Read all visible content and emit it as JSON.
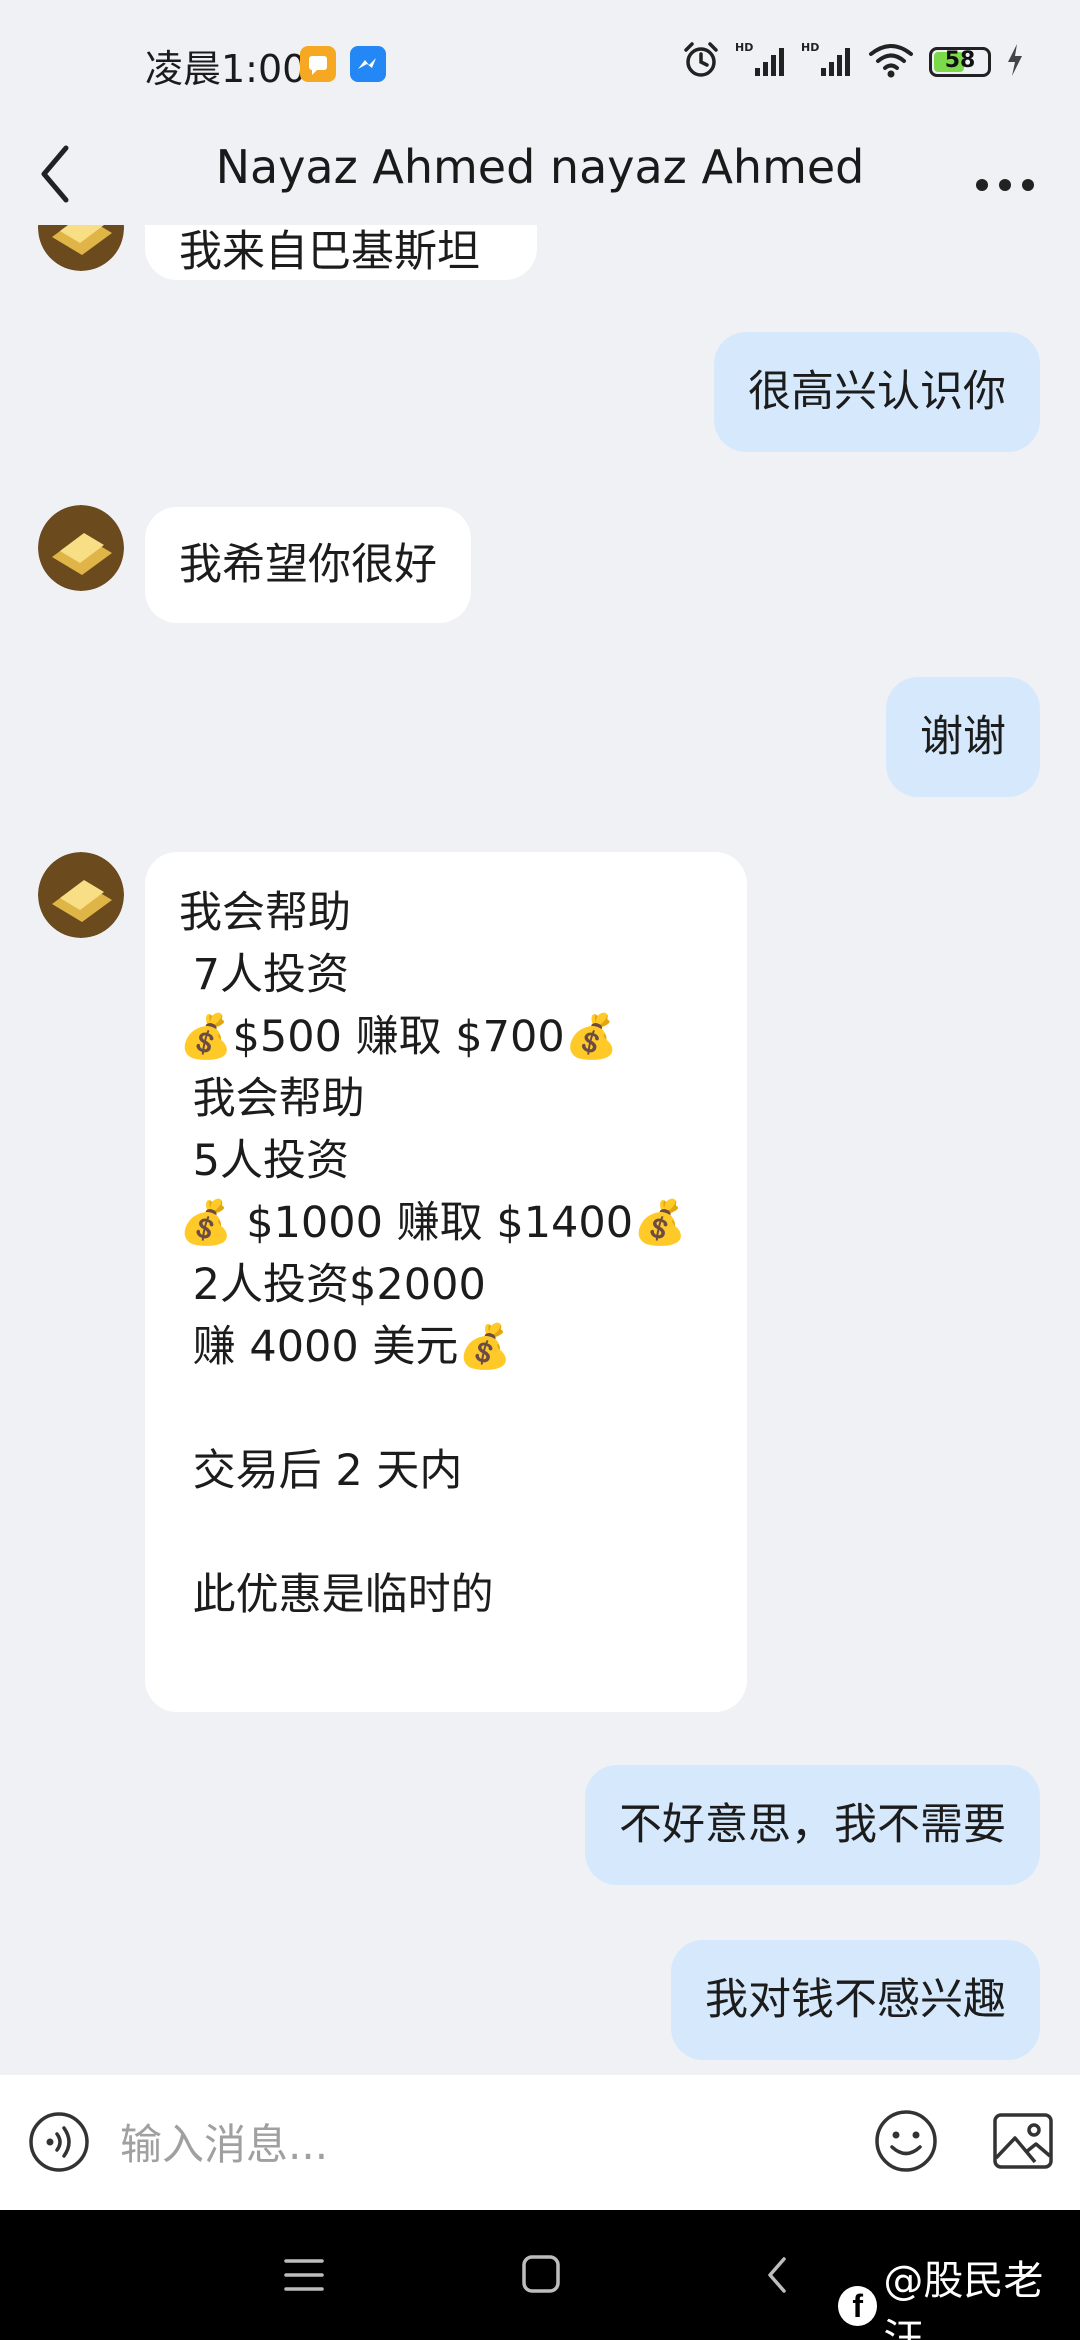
{
  "status_bar": {
    "time": "凌晨1:00",
    "battery": "58",
    "battery_level": 0.58,
    "icons": [
      "notification-app-icon",
      "messenger-app-icon",
      "alarm-icon",
      "signal-hd-icon",
      "signal-hd-icon",
      "wifi-icon",
      "battery-icon",
      "charging-icon"
    ]
  },
  "header": {
    "title": "Nayaz Ahmed nayaz Ahmed",
    "back_icon": "chevron-left-icon",
    "more_icon": "more-dots-icon"
  },
  "messages": [
    {
      "direction": "in",
      "lines": [
        "我来自巴基斯坦"
      ],
      "partial": true
    },
    {
      "direction": "out",
      "lines": [
        "很高兴认识你"
      ]
    },
    {
      "direction": "in",
      "lines": [
        "我希望你很好"
      ]
    },
    {
      "direction": "out",
      "lines": [
        "谢谢"
      ]
    },
    {
      "direction": "in",
      "lines": [
        "我会帮助",
        " 7人投资",
        "💰$500 赚取 $700💰",
        " 我会帮助",
        " 5人投资",
        "💰 $1000 赚取 $1400💰",
        " 2人投资$2000",
        " 赚 4000 美元💰",
        "",
        " 交易后 2 天内",
        "",
        " 此优惠是临时的"
      ]
    },
    {
      "direction": "out",
      "lines": [
        "不好意思，我不需要"
      ]
    },
    {
      "direction": "out",
      "lines": [
        "我对钱不感兴趣"
      ]
    }
  ],
  "input": {
    "placeholder": "输入消息...",
    "value": "",
    "voice_icon": "voice-icon",
    "emoji_icon": "emoji-icon",
    "image_icon": "image-icon"
  },
  "nav_bar": {
    "watermark": "@股民老汪",
    "watermark_logo": "f"
  },
  "colors": {
    "background": "#f0f1f5",
    "incoming_bubble": "#ffffff",
    "outgoing_bubble": "#d6e9fc",
    "battery_fill": "#7cd94a"
  }
}
